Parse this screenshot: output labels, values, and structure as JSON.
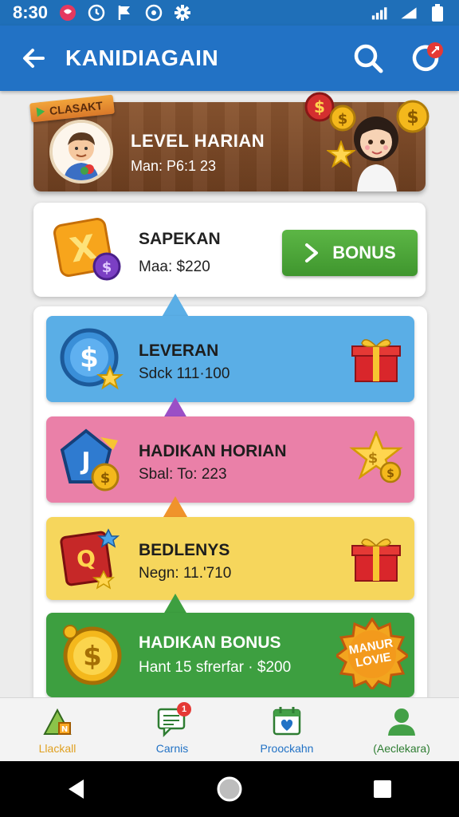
{
  "status_bar": {
    "time": "8:30"
  },
  "app_bar": {
    "title": "KANIDIAGAIN"
  },
  "level_banner": {
    "ribbon": "CLASAKT",
    "title": "LEVEL HARIAN",
    "subtitle": "Man: P6:1 23"
  },
  "weekly_card": {
    "title": "SAPEKAN",
    "subtitle": "Maa: $220",
    "button_label": "BONUS"
  },
  "rows": [
    {
      "title": "LEVERAN",
      "subtitle": "Sdck 111·100",
      "color": "#5aaee6"
    },
    {
      "title": "HADIKAN HORIAN",
      "subtitle": "Sbal: To: 223",
      "color": "#ea80a8"
    },
    {
      "title": "BEDLENYS",
      "subtitle": "Negn: 11.'710",
      "color": "#f6d65c"
    },
    {
      "title": "HADIKAN BONUS",
      "subtitle": "Hant 15 sfrerfar · $200",
      "color": "#3d9f40",
      "badge_line1": "MANUR",
      "badge_line2": "LOVIE"
    }
  ],
  "bottom_nav": {
    "items": [
      {
        "label": "Llackall",
        "color": "#e0a020"
      },
      {
        "label": "Carnis",
        "color": "#2272c5"
      },
      {
        "label": "Proockahn",
        "color": "#2272c5"
      },
      {
        "label": "(Aeclekara)",
        "color": "#2e7d32"
      }
    ],
    "badge_count": "1"
  },
  "colors": {
    "primary": "#2272c5",
    "bonus_green": "#4caf3a"
  }
}
